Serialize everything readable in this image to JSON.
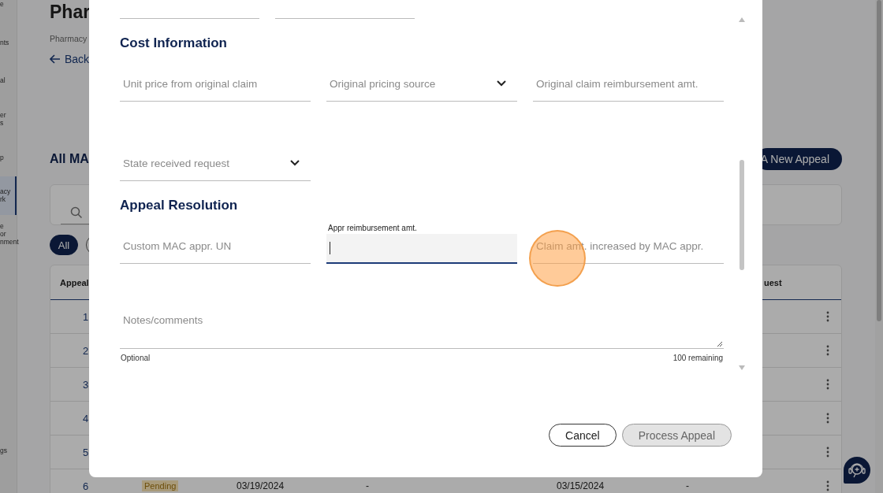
{
  "sidebar": {
    "items": [
      {
        "lines": [
          "e"
        ],
        "selected": false
      },
      {
        "lines": [
          "nts"
        ],
        "selected": false
      },
      {
        "lines": [
          "al"
        ],
        "selected": false
      },
      {
        "lines": [
          "er",
          "s"
        ],
        "selected": false
      },
      {
        "lines": [
          "p"
        ],
        "selected": false
      },
      {
        "lines": [
          "acy",
          "rk"
        ],
        "selected": true
      },
      {
        "lines": [
          "e",
          "or",
          "nment"
        ],
        "selected": false
      },
      {
        "lines": [
          "gs"
        ],
        "selected": false
      }
    ]
  },
  "page": {
    "title": "Phar",
    "breadcrumb": "Pharmacy",
    "back_link": "Back",
    "section_title": "All MA",
    "new_appeal_button": "A New Appeal",
    "filter_chips": [
      {
        "label": "All",
        "selected": true
      }
    ]
  },
  "table": {
    "columns": [
      "Appeal",
      "uest"
    ],
    "rows": [
      {
        "appeal": "1"
      },
      {
        "appeal": "2"
      },
      {
        "appeal": "3"
      },
      {
        "appeal": "4"
      },
      {
        "appeal": "5"
      },
      {
        "appeal": "6",
        "status": "Pending",
        "column_3": "03/19/2024",
        "column_4": "-",
        "column_5": "03/15/2024",
        "column_6": "-"
      }
    ]
  },
  "modal": {
    "sections": [
      {
        "title": "Cost Information",
        "fields": [
          {
            "kind": "text",
            "placeholder": "Unit price from original claim",
            "focused": false
          },
          {
            "kind": "select",
            "placeholder": "Original pricing source",
            "focused": false
          },
          {
            "kind": "text",
            "placeholder": "Original claim reimbursement amt.",
            "focused": false
          },
          {
            "kind": "select",
            "placeholder": "State received request",
            "focused": false
          }
        ]
      },
      {
        "title": "Appeal Resolution",
        "fields": [
          {
            "kind": "text",
            "placeholder": "Custom MAC appr. UN",
            "focused": false
          },
          {
            "kind": "text",
            "label": "Appr reimbursement amt.",
            "focused": true
          },
          {
            "kind": "text",
            "placeholder": "Claim amt. increased by MAC appr.",
            "focused": false
          }
        ]
      }
    ],
    "notes": {
      "placeholder": "Notes/comments",
      "helper": "Optional",
      "counter": "100 remaining"
    },
    "buttons": [
      {
        "label": "Cancel",
        "disabled": false
      },
      {
        "label": "Process Appeal",
        "disabled": true
      }
    ]
  }
}
